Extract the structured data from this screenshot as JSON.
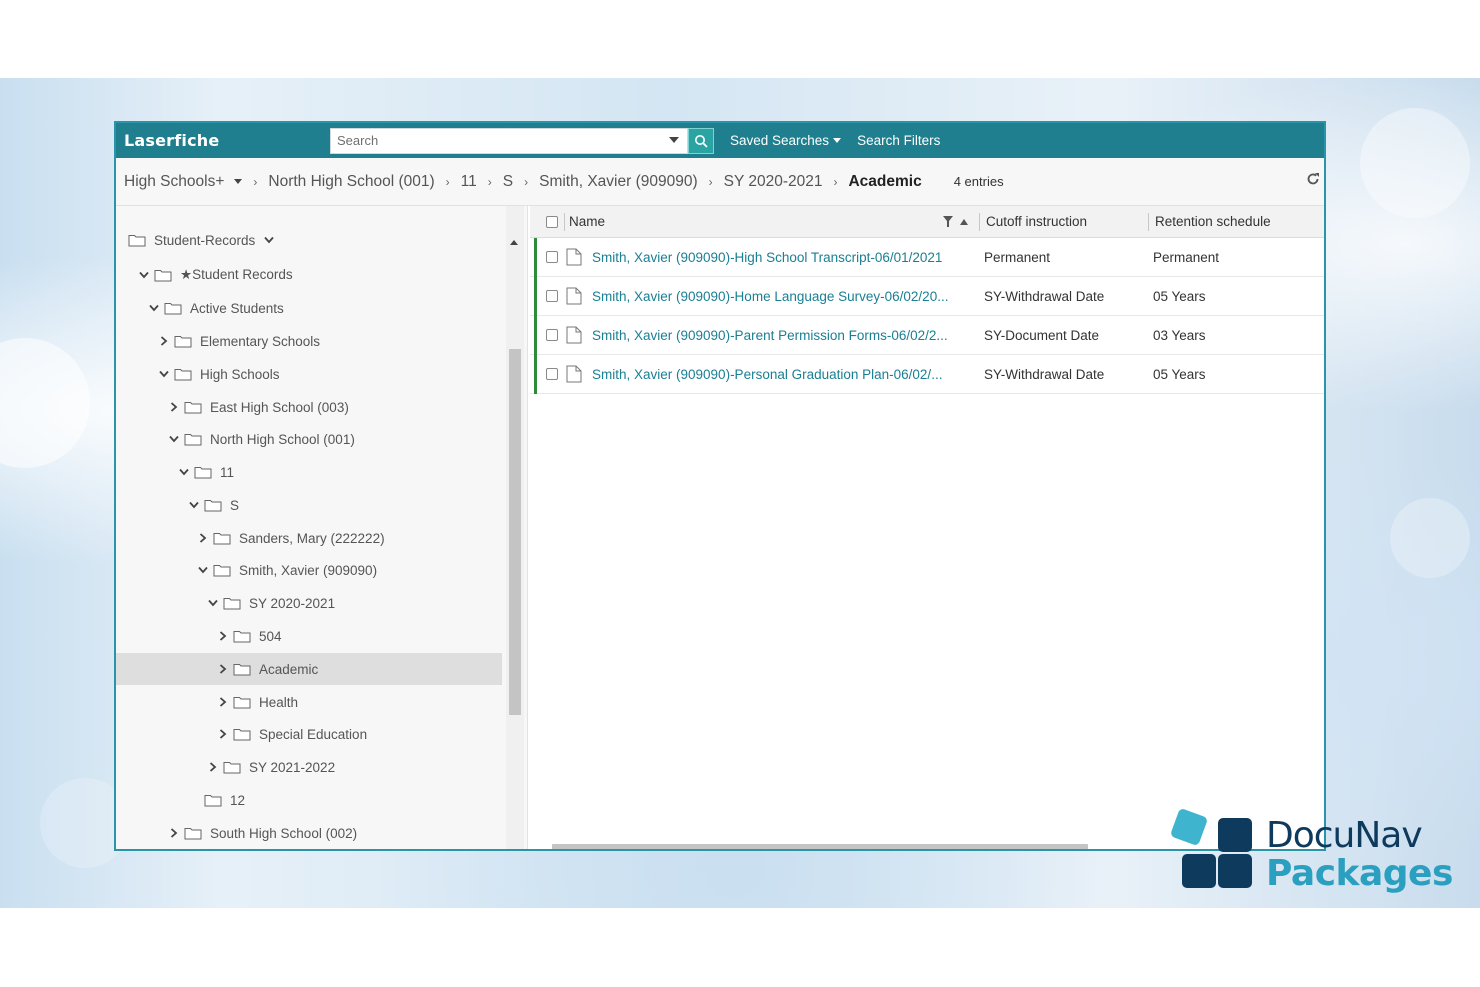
{
  "app": {
    "logo": "Laserfiche",
    "search": {
      "placeholder": "Search"
    },
    "saved_searches": "Saved Searches",
    "search_filters": "Search Filters"
  },
  "breadcrumb": {
    "items": [
      "High Schools+",
      "North High School (001)",
      "11",
      "S",
      "Smith, Xavier (909090)",
      "SY 2020-2021"
    ],
    "current": "Academic",
    "entries": "4 entries"
  },
  "tree": {
    "items": [
      {
        "label": "Student-Records"
      },
      {
        "label": "★Student Records"
      },
      {
        "label": "Active Students"
      },
      {
        "label": "Elementary Schools"
      },
      {
        "label": "High Schools"
      },
      {
        "label": "East High School (003)"
      },
      {
        "label": "North High School (001)"
      },
      {
        "label": "11"
      },
      {
        "label": "S"
      },
      {
        "label": "Sanders, Mary (222222)"
      },
      {
        "label": "Smith, Xavier (909090)"
      },
      {
        "label": "SY 2020-2021"
      },
      {
        "label": "504"
      },
      {
        "label": "Academic"
      },
      {
        "label": "Health"
      },
      {
        "label": "Special Education"
      },
      {
        "label": "SY 2021-2022"
      },
      {
        "label": "12"
      },
      {
        "label": "South High School (002)"
      }
    ]
  },
  "list": {
    "columns": [
      "Name",
      "Cutoff instruction",
      "Retention schedule"
    ],
    "rows": [
      {
        "name": "Smith, Xavier (909090)-High School Transcript-06/01/2021",
        "cutoff": "Permanent",
        "retention": "Permanent"
      },
      {
        "name": "Smith, Xavier (909090)-Home Language Survey-06/02/20...",
        "cutoff": "SY-Withdrawal Date",
        "retention": "05 Years"
      },
      {
        "name": "Smith, Xavier (909090)-Parent Permission Forms-06/02/2...",
        "cutoff": "SY-Document Date",
        "retention": "03 Years"
      },
      {
        "name": "Smith, Xavier (909090)-Personal Graduation Plan-06/02/...",
        "cutoff": "SY-Withdrawal Date",
        "retention": "05 Years"
      }
    ]
  },
  "branding": {
    "line1": "DocuNav",
    "line2": "Packages"
  },
  "colors": {
    "topbar": "#1f7f8f",
    "link": "#1a7f93",
    "row_accent": "#2e8b3a",
    "brand_dark": "#0e3a5e",
    "brand_light": "#2a9fc0"
  }
}
